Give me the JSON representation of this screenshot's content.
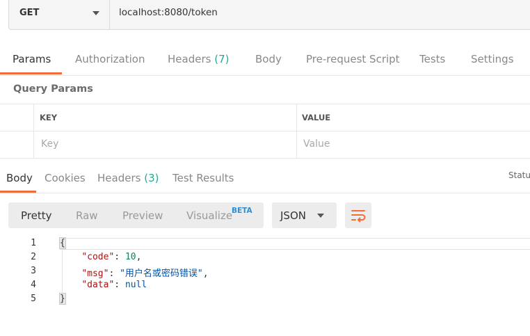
{
  "request": {
    "method": "GET",
    "url": "localhost:8080/token"
  },
  "request_tabs": [
    {
      "label": "Params",
      "active": true
    },
    {
      "label": "Authorization"
    },
    {
      "label": "Headers",
      "count": "(7)"
    },
    {
      "label": "Body"
    },
    {
      "label": "Pre-request Script"
    },
    {
      "label": "Tests"
    },
    {
      "label": "Settings"
    }
  ],
  "query_params": {
    "title": "Query Params",
    "key_header": "KEY",
    "value_header": "VALUE",
    "key_placeholder": "Key",
    "value_placeholder": "Value"
  },
  "response_tabs": [
    {
      "label": "Body",
      "active": true
    },
    {
      "label": "Cookies"
    },
    {
      "label": "Headers",
      "count": "(3)"
    },
    {
      "label": "Test Results"
    }
  ],
  "status_label": "Statu",
  "format_options": [
    {
      "label": "Pretty",
      "active": true
    },
    {
      "label": "Raw"
    },
    {
      "label": "Preview"
    },
    {
      "label": "Visualize",
      "badge": "BETA"
    }
  ],
  "response_format": "JSON",
  "icons": {
    "wrap": "wrap-lines-icon",
    "accent_color": "#f26b3a"
  },
  "code_lines": [
    {
      "num": "1",
      "text": "{"
    },
    {
      "num": "2",
      "key": "\"code\"",
      "value": "10",
      "trail": ","
    },
    {
      "num": "3",
      "key": "\"msg\"",
      "value": "\"用户名或密码错误\"",
      "trail": ","
    },
    {
      "num": "4",
      "key": "\"data\"",
      "value": "null",
      "trail": ""
    },
    {
      "num": "5",
      "text": "}"
    }
  ]
}
